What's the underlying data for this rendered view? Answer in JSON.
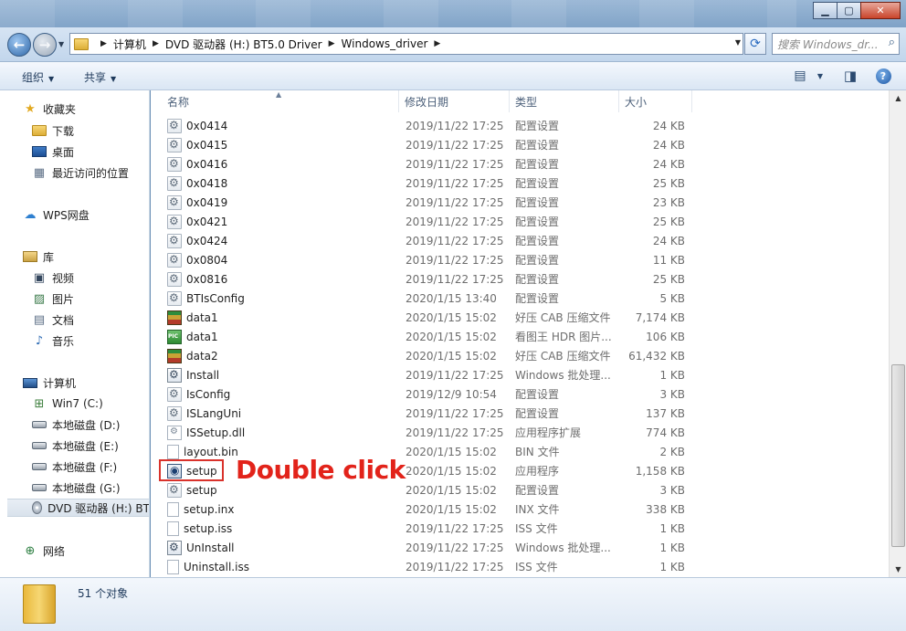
{
  "window": {
    "minimize_icon": "minimize-icon",
    "maximize_icon": "maximize-icon",
    "close_icon": "close-icon"
  },
  "address": {
    "segments": [
      "计算机",
      "DVD 驱动器 (H:) BT5.0 Driver",
      "Windows_driver"
    ],
    "search_placeholder": "搜索 Windows_dr..."
  },
  "toolbar": {
    "organize": "组织",
    "share": "共享"
  },
  "nav": {
    "favorites": "收藏夹",
    "downloads": "下载",
    "desktop": "桌面",
    "recent": "最近访问的位置",
    "wps": "WPS网盘",
    "libraries": "库",
    "videos": "视频",
    "pictures": "图片",
    "documents": "文档",
    "music": "音乐",
    "computer": "计算机",
    "drive_c": "Win7 (C:)",
    "drive_d": "本地磁盘 (D:)",
    "drive_e": "本地磁盘 (E:)",
    "drive_f": "本地磁盘 (F:)",
    "drive_g": "本地磁盘 (G:)",
    "drive_h": "DVD 驱动器 (H:) BT",
    "network": "网络"
  },
  "columns": {
    "name": "名称",
    "date": "修改日期",
    "type": "类型",
    "size": "大小"
  },
  "files": [
    {
      "name": "0x0414",
      "date": "2019/11/22 17:25",
      "type": "配置设置",
      "size": "24 KB",
      "icon": "cfg"
    },
    {
      "name": "0x0415",
      "date": "2019/11/22 17:25",
      "type": "配置设置",
      "size": "24 KB",
      "icon": "cfg"
    },
    {
      "name": "0x0416",
      "date": "2019/11/22 17:25",
      "type": "配置设置",
      "size": "24 KB",
      "icon": "cfg"
    },
    {
      "name": "0x0418",
      "date": "2019/11/22 17:25",
      "type": "配置设置",
      "size": "25 KB",
      "icon": "cfg"
    },
    {
      "name": "0x0419",
      "date": "2019/11/22 17:25",
      "type": "配置设置",
      "size": "23 KB",
      "icon": "cfg"
    },
    {
      "name": "0x0421",
      "date": "2019/11/22 17:25",
      "type": "配置设置",
      "size": "25 KB",
      "icon": "cfg"
    },
    {
      "name": "0x0424",
      "date": "2019/11/22 17:25",
      "type": "配置设置",
      "size": "24 KB",
      "icon": "cfg"
    },
    {
      "name": "0x0804",
      "date": "2019/11/22 17:25",
      "type": "配置设置",
      "size": "11 KB",
      "icon": "cfg"
    },
    {
      "name": "0x0816",
      "date": "2019/11/22 17:25",
      "type": "配置设置",
      "size": "25 KB",
      "icon": "cfg"
    },
    {
      "name": "BTIsConfig",
      "date": "2020/1/15 13:40",
      "type": "配置设置",
      "size": "5 KB",
      "icon": "cfg"
    },
    {
      "name": "data1",
      "date": "2020/1/15 15:02",
      "type": "好压 CAB 压缩文件",
      "size": "7,174 KB",
      "icon": "cab"
    },
    {
      "name": "data1",
      "date": "2020/1/15 15:02",
      "type": "看图王 HDR 图片...",
      "size": "106 KB",
      "icon": "pic"
    },
    {
      "name": "data2",
      "date": "2020/1/15 15:02",
      "type": "好压 CAB 压缩文件",
      "size": "61,432 KB",
      "icon": "cab"
    },
    {
      "name": "Install",
      "date": "2019/11/22 17:25",
      "type": "Windows 批处理...",
      "size": "1 KB",
      "icon": "bat"
    },
    {
      "name": "IsConfig",
      "date": "2019/12/9 10:54",
      "type": "配置设置",
      "size": "3 KB",
      "icon": "cfg"
    },
    {
      "name": "ISLangUni",
      "date": "2019/11/22 17:25",
      "type": "配置设置",
      "size": "137 KB",
      "icon": "cfg"
    },
    {
      "name": "ISSetup.dll",
      "date": "2019/11/22 17:25",
      "type": "应用程序扩展",
      "size": "774 KB",
      "icon": "dll"
    },
    {
      "name": "layout.bin",
      "date": "2020/1/15 15:02",
      "type": "BIN 文件",
      "size": "2 KB",
      "icon": "blank"
    },
    {
      "name": "setup",
      "date": "2020/1/15 15:02",
      "type": "应用程序",
      "size": "1,158 KB",
      "icon": "exe"
    },
    {
      "name": "setup",
      "date": "2020/1/15 15:02",
      "type": "配置设置",
      "size": "3 KB",
      "icon": "cfg"
    },
    {
      "name": "setup.inx",
      "date": "2020/1/15 15:02",
      "type": "INX 文件",
      "size": "338 KB",
      "icon": "blank"
    },
    {
      "name": "setup.iss",
      "date": "2019/11/22 17:25",
      "type": "ISS 文件",
      "size": "1 KB",
      "icon": "blank"
    },
    {
      "name": "UnInstall",
      "date": "2019/11/22 17:25",
      "type": "Windows 批处理...",
      "size": "1 KB",
      "icon": "bat"
    },
    {
      "name": "Uninstall.iss",
      "date": "2019/11/22 17:25",
      "type": "ISS 文件",
      "size": "1 KB",
      "icon": "blank"
    }
  ],
  "annotation": {
    "text": "Double click",
    "color": "#e2231a"
  },
  "status": {
    "count": "51 个对象"
  }
}
